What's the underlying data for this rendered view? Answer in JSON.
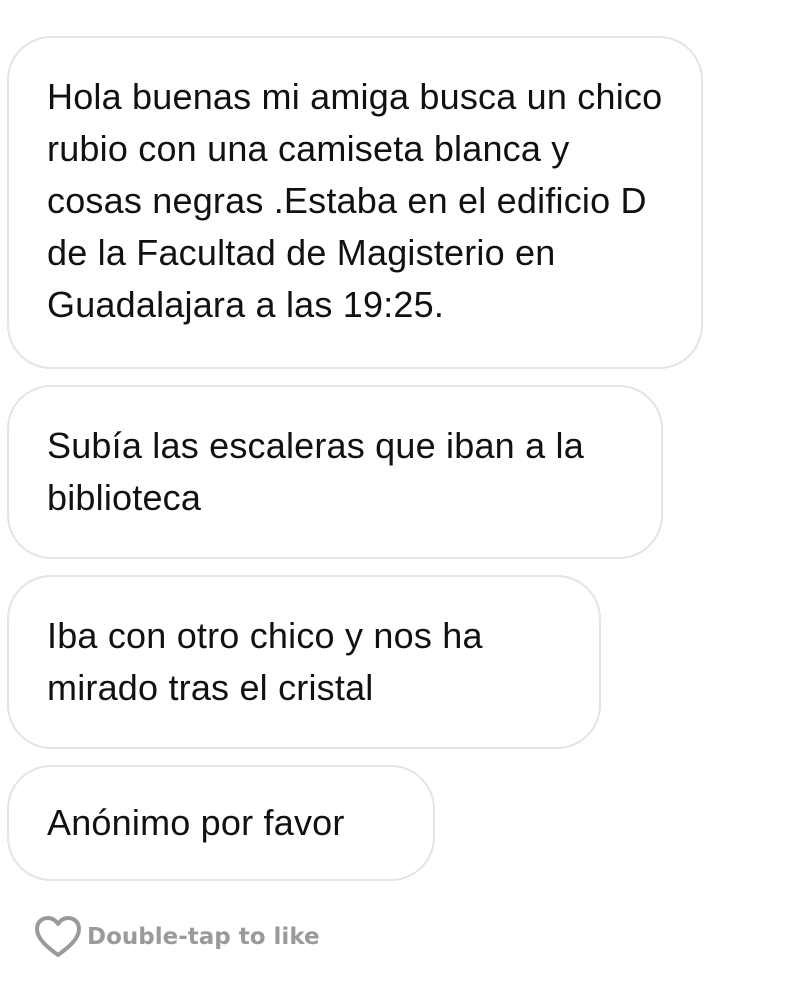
{
  "messages": [
    {
      "text": "Hola buenas mi amiga busca un chico rubio con una camiseta blanca y cosas negras .Estaba en el edificio D de la Facultad de Magisterio en Guadalajara a las 19:25."
    },
    {
      "text": "Subía las escaleras que iban a la biblioteca"
    },
    {
      "text": "Iba con otro chico y nos ha mirado tras el cristal"
    },
    {
      "text": "Anónimo por favor"
    }
  ],
  "like_hint": {
    "icon": "heart-icon",
    "label": "Double-tap to like"
  },
  "colors": {
    "bubble_border": "#e4e4e4",
    "text": "#111111",
    "hint": "#9a9a9a"
  }
}
